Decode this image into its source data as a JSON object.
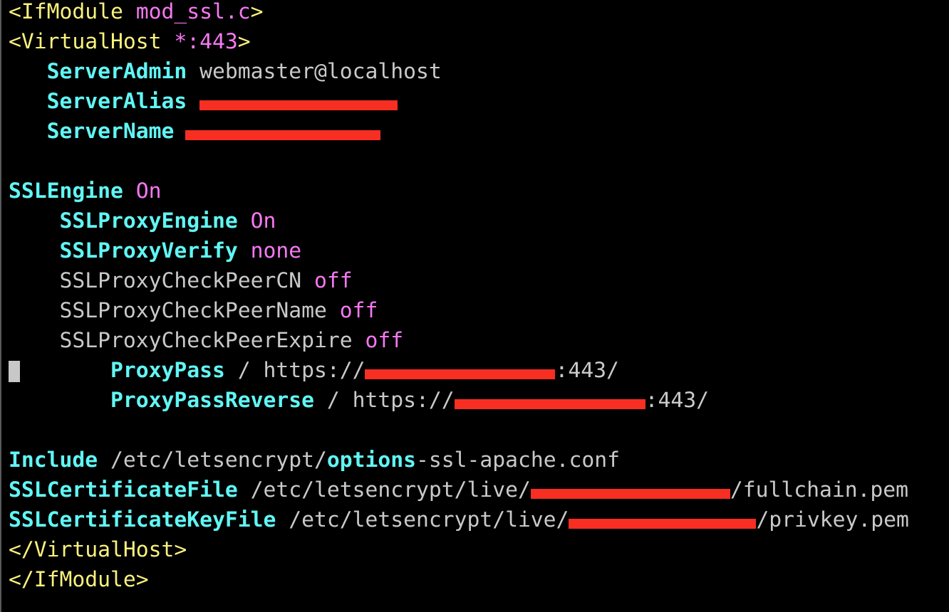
{
  "editor": {
    "colors": {
      "tag": "#f9f27c",
      "value": "#f778f2",
      "keyword": "#60f6f4",
      "text": "#c9c9c9",
      "redaction": "#f72e22"
    },
    "cursor_line": 12,
    "lines": [
      [
        {
          "t": "<IfModule ",
          "c": "yellow"
        },
        {
          "t": "mod_ssl.c",
          "c": "magenta"
        },
        {
          "t": ">",
          "c": "yellow"
        }
      ],
      [
        {
          "t": "<VirtualHost ",
          "c": "yellow"
        },
        {
          "t": "*:443",
          "c": "magenta"
        },
        {
          "t": ">",
          "c": "yellow"
        }
      ],
      [
        {
          "t": "   "
        },
        {
          "t": "ServerAdmin",
          "c": "cyan"
        },
        {
          "t": " webmaster@localhost",
          "c": "gray"
        }
      ],
      [
        {
          "t": "   "
        },
        {
          "t": "ServerAlias",
          "c": "cyan"
        },
        {
          "t": " "
        },
        {
          "redacted": true
        }
      ],
      [
        {
          "t": "   "
        },
        {
          "t": "ServerName",
          "c": "cyan"
        },
        {
          "t": " "
        },
        {
          "redacted": true
        }
      ],
      [],
      [
        {
          "t": "SSLEngine",
          "c": "cyan"
        },
        {
          "t": " "
        },
        {
          "t": "On",
          "c": "magenta"
        }
      ],
      [
        {
          "t": "    "
        },
        {
          "t": "SSLProxyEngine",
          "c": "cyan"
        },
        {
          "t": " "
        },
        {
          "t": "On",
          "c": "magenta"
        }
      ],
      [
        {
          "t": "    "
        },
        {
          "t": "SSLProxyVerify",
          "c": "cyan"
        },
        {
          "t": " "
        },
        {
          "t": "none",
          "c": "magenta"
        }
      ],
      [
        {
          "t": "    SSLProxyCheckPeerCN ",
          "c": "gray"
        },
        {
          "t": "off",
          "c": "magenta"
        }
      ],
      [
        {
          "t": "    SSLProxyCheckPeerName ",
          "c": "gray"
        },
        {
          "t": "off",
          "c": "magenta"
        }
      ],
      [
        {
          "t": "    SSLProxyCheckPeerExpire ",
          "c": "gray"
        },
        {
          "t": "off",
          "c": "magenta"
        }
      ],
      [
        {
          "t": "        "
        },
        {
          "t": "ProxyPass",
          "c": "cyan"
        },
        {
          "t": " / https://",
          "c": "gray"
        },
        {
          "redacted": true
        },
        {
          "t": ":443/",
          "c": "gray"
        }
      ],
      [
        {
          "t": "        "
        },
        {
          "t": "ProxyPassReverse",
          "c": "cyan"
        },
        {
          "t": " / https://",
          "c": "gray"
        },
        {
          "redacted": true
        },
        {
          "t": ":443/",
          "c": "gray"
        }
      ],
      [],
      [
        {
          "t": "Include",
          "c": "cyan"
        },
        {
          "t": " /etc/letsencrypt/",
          "c": "gray"
        },
        {
          "t": "options",
          "c": "cyan"
        },
        {
          "t": "-ssl-apache.conf",
          "c": "gray"
        }
      ],
      [
        {
          "t": "SSLCertificateFile",
          "c": "cyan"
        },
        {
          "t": " /etc/letsencrypt/live/",
          "c": "gray"
        },
        {
          "redacted": true
        },
        {
          "t": "/fullchain.pem",
          "c": "gray"
        }
      ],
      [
        {
          "t": "SSLCertificateKeyFile",
          "c": "cyan"
        },
        {
          "t": " /etc/letsencrypt/live/",
          "c": "gray"
        },
        {
          "redacted": true
        },
        {
          "t": "/privkey.pem",
          "c": "gray"
        }
      ],
      [
        {
          "t": "</VirtualHost>",
          "c": "yellow"
        }
      ],
      [
        {
          "t": "</IfModule>",
          "c": "yellow"
        }
      ]
    ]
  }
}
